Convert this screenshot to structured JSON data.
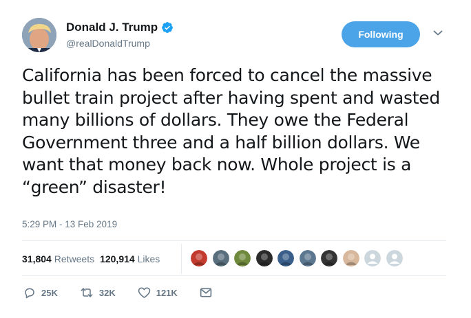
{
  "author": {
    "display_name": "Donald J. Trump",
    "handle": "@realDonaldTrump",
    "verified": true
  },
  "follow_button": {
    "label": "Following"
  },
  "tweet": {
    "text": "California has been forced to cancel the massive bullet train project after having spent and wasted many billions of dollars. They owe the Federal Government three and a half billion dollars. We want that money back now. Whole project is a “green” disaster!",
    "timestamp": "5:29 PM - 13 Feb 2019"
  },
  "stats": {
    "retweets_count": "31,804",
    "retweets_label": "Retweets",
    "likes_count": "120,914",
    "likes_label": "Likes"
  },
  "likers": [
    {
      "color": "#c23b2e"
    },
    {
      "color": "#5a6f7e"
    },
    {
      "color": "#6f8a3c"
    },
    {
      "color": "#2b2b2b"
    },
    {
      "color": "#3a5f8a"
    },
    {
      "color": "#5c7890"
    },
    {
      "color": "#333333"
    },
    {
      "color": "#d7b89c"
    },
    {
      "color": "#ccd6dd",
      "placeholder": true
    },
    {
      "color": "#ccd6dd",
      "placeholder": true
    }
  ],
  "actions": {
    "reply_count": "25K",
    "retweet_count": "32K",
    "like_count": "121K"
  },
  "colors": {
    "accent": "#1da1f2",
    "follow_bg": "#4ba3e8",
    "muted_text": "#657786",
    "divider": "#e6ecf0"
  }
}
